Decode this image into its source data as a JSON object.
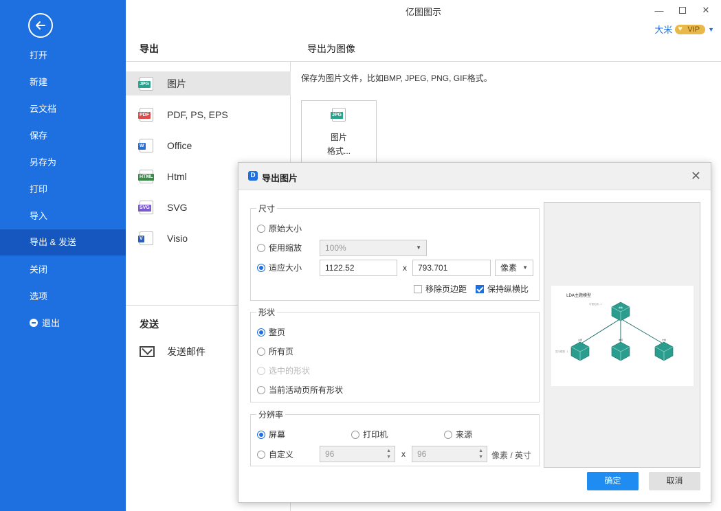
{
  "app": {
    "title": "亿图图示"
  },
  "user": {
    "name": "大米",
    "badge": "VIP"
  },
  "sidebar": {
    "items": [
      {
        "label": "打开"
      },
      {
        "label": "新建"
      },
      {
        "label": "云文档"
      },
      {
        "label": "保存"
      },
      {
        "label": "另存为"
      },
      {
        "label": "打印"
      },
      {
        "label": "导入"
      },
      {
        "label": "导出 & 发送",
        "active": true
      },
      {
        "label": "关闭"
      },
      {
        "label": "选项"
      },
      {
        "label": "退出"
      }
    ]
  },
  "export": {
    "heading": "导出",
    "items": [
      {
        "label": "图片",
        "tag": "JPG",
        "color": "#2aa38c",
        "active": true
      },
      {
        "label": "PDF, PS, EPS",
        "tag": "PDF",
        "color": "#e04a4a"
      },
      {
        "label": "Office",
        "tag": "W",
        "color": "#2b6fd6"
      },
      {
        "label": "Html",
        "tag": "HTML",
        "color": "#3a8a4a"
      },
      {
        "label": "SVG",
        "tag": "SVG",
        "color": "#7a5bd0"
      },
      {
        "label": "Visio",
        "tag": "V",
        "color": "#2b5fbf"
      }
    ],
    "send_heading": "发送",
    "send_mail": "发送邮件"
  },
  "image_panel": {
    "heading": "导出为图像",
    "description": "保存为图片文件，比如BMP, JPEG, PNG, GIF格式。",
    "tile_line1": "图片",
    "tile_line2": "格式...",
    "tile_tag": "JPG"
  },
  "dialog": {
    "title": "导出图片",
    "size": {
      "legend": "尺寸",
      "original": "原始大小",
      "use_scale": "使用缩放",
      "scale_value": "100%",
      "fit": "适应大小",
      "width": "1122.52",
      "height": "793.701",
      "times": "x",
      "unit": "像素",
      "remove_margin": "移除页边距",
      "keep_ratio": "保持纵横比"
    },
    "shape": {
      "legend": "形状",
      "whole_page": "整页",
      "all_pages": "所有页",
      "selected": "选中的形状",
      "current_page_shapes": "当前活动页所有形状"
    },
    "resolution": {
      "legend": "分辨率",
      "screen": "屏幕",
      "printer": "打印机",
      "source": "来源",
      "custom": "自定义",
      "dpi_x": "96",
      "dpi_y": "96",
      "times": "x",
      "unit": "像素 / 英寸"
    },
    "preview": {
      "title": "LDA主题模型",
      "note1": "可视化到 -1",
      "note2": "显示模型 -1",
      "top_label": "参数",
      "child_labels": [
        "主题",
        "单词",
        "文档"
      ]
    },
    "ok": "确定",
    "cancel": "取消"
  },
  "colors": {
    "accent": "#1e6fe0",
    "teal": "#2a9d8f"
  }
}
